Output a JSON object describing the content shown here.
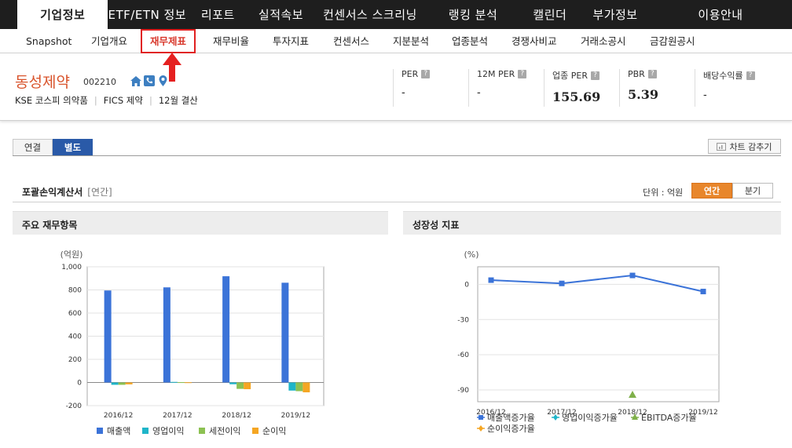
{
  "topnav": {
    "tabs": [
      {
        "label": "기업정보",
        "active": true
      },
      {
        "label": "ETF/ETN 정보",
        "active": false
      },
      {
        "label": "리포트",
        "active": false
      },
      {
        "label": "실적속보",
        "active": false
      },
      {
        "label": "컨센서스 스크리닝",
        "active": false
      },
      {
        "label": "랭킹 분석",
        "active": false
      },
      {
        "label": "캘린더",
        "active": false
      },
      {
        "label": "부가정보",
        "active": false
      },
      {
        "label": "이용안내",
        "active": false
      }
    ]
  },
  "subnav": {
    "items": [
      {
        "label": "Snapshot",
        "active": false
      },
      {
        "label": "기업개요",
        "active": false
      },
      {
        "label": "재무제표",
        "active": true
      },
      {
        "label": "재무비율",
        "active": false
      },
      {
        "label": "투자지표",
        "active": false
      },
      {
        "label": "컨센서스",
        "active": false
      },
      {
        "label": "지분분석",
        "active": false
      },
      {
        "label": "업종분석",
        "active": false
      },
      {
        "label": "경쟁사비교",
        "active": false
      },
      {
        "label": "거래소공시",
        "active": false
      },
      {
        "label": "금감원공시",
        "active": false
      }
    ]
  },
  "company": {
    "name": "동성제약",
    "code": "002210",
    "market": "KSE  코스피 의약품",
    "fics": "FICS 제약",
    "fiscal": "12월 결산",
    "icons": [
      "home-icon",
      "phone-icon",
      "location-icon"
    ]
  },
  "metrics": [
    {
      "label": "PER",
      "value": "-"
    },
    {
      "label": "12M PER",
      "value": "-"
    },
    {
      "label": "업종 PER",
      "value": "155.69"
    },
    {
      "label": "PBR",
      "value": "5.39"
    },
    {
      "label": "배당수익률",
      "value": "-"
    }
  ],
  "view_tabs": [
    {
      "label": "연결",
      "active": false
    },
    {
      "label": "별도",
      "active": true
    }
  ],
  "hide_chart_label": "차트 감추기",
  "section": {
    "title": "포괄손익계산서",
    "subtitle": "[연간]",
    "unit_label": "단위 : 억원",
    "period_buttons": [
      {
        "label": "연간",
        "active": true
      },
      {
        "label": "분기",
        "active": false
      }
    ]
  },
  "colors": {
    "accent_blue": "#2a5aa8",
    "accent_orange": "#e8862b",
    "company_name": "#d9542c",
    "highlight_red": "#e02020"
  },
  "chart_data": [
    {
      "type": "bar",
      "panel_title": "주요 재무항목",
      "ylabel": "(억원)",
      "categories": [
        "2016/12",
        "2017/12",
        "2018/12",
        "2019/12"
      ],
      "ylim": [
        -200,
        1000
      ],
      "yticks": [
        -200,
        0,
        200,
        400,
        600,
        800,
        1000
      ],
      "ytick_labels": [
        "-200",
        "0",
        "200",
        "400",
        "600",
        "800",
        "1,000"
      ],
      "grid": true,
      "legend_position": "bottom",
      "series": [
        {
          "name": "매출액",
          "color": "#3b73d8",
          "values": [
            795,
            822,
            918,
            862
          ]
        },
        {
          "name": "영업이익",
          "color": "#1fb5c9",
          "values": [
            -20,
            5,
            -15,
            -70
          ]
        },
        {
          "name": "세전이익",
          "color": "#8cc152",
          "values": [
            -20,
            3,
            -55,
            -75
          ]
        },
        {
          "name": "순이익",
          "color": "#f5a623",
          "values": [
            -16,
            2,
            -58,
            -85
          ]
        }
      ]
    },
    {
      "type": "line",
      "panel_title": "성장성 지표",
      "ylabel": "(%)",
      "categories": [
        "2016/12",
        "2017/12",
        "2018/12",
        "2019/12"
      ],
      "ylim": [
        -100,
        15
      ],
      "yticks": [
        -90,
        -60,
        -30,
        0
      ],
      "ytick_labels": [
        "-90",
        "-60",
        "-30",
        "0"
      ],
      "grid": true,
      "legend_position": "bottom",
      "series": [
        {
          "name": "매출액증가율",
          "color": "#3b73d8",
          "marker": "square",
          "values": [
            3.6,
            0.8,
            7.6,
            -6.1
          ]
        },
        {
          "name": "영업이익증가율",
          "color": "#1fb5c9",
          "marker": "diamond",
          "values": [
            null,
            null,
            null,
            null
          ]
        },
        {
          "name": "EBITDA증가율",
          "color": "#7fb04a",
          "marker": "triangle",
          "values": [
            null,
            null,
            -94,
            null
          ]
        },
        {
          "name": "순이익증가율",
          "color": "#f5a623",
          "marker": "diamond",
          "values": [
            null,
            null,
            null,
            null
          ]
        }
      ]
    }
  ]
}
